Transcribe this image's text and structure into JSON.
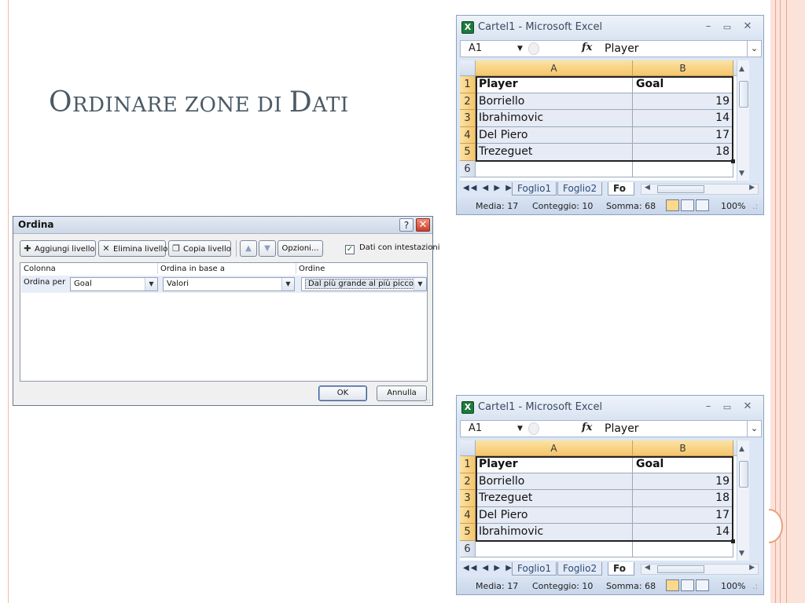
{
  "slide": {
    "title_first_cap": "O",
    "title_rest": "RDINARE ZONE DI ",
    "title_last_cap": "D",
    "title_last_rest": "ATI"
  },
  "colors": {
    "accent_line": "#f0a590",
    "title": "#4a5a66",
    "excel_header": "#f5c56a"
  },
  "excel_before": {
    "window_title": "Cartel1 - Microsoft Excel",
    "logo_icon": "excel-icon",
    "name_box": "A1",
    "fx": "fx",
    "formula_value": "Player",
    "columns": [
      "A",
      "B"
    ],
    "rows": [
      {
        "n": "1",
        "a": "Player",
        "b": "Goal"
      },
      {
        "n": "2",
        "a": "Borriello",
        "b": "19"
      },
      {
        "n": "3",
        "a": "Ibrahimovic",
        "b": "14"
      },
      {
        "n": "4",
        "a": "Del Piero",
        "b": "17"
      },
      {
        "n": "5",
        "a": "Trezeguet",
        "b": "18"
      },
      {
        "n": "6",
        "a": "",
        "b": ""
      }
    ],
    "sheet_tabs": [
      "Foglio1",
      "Foglio2",
      "Fo"
    ],
    "status": {
      "media": "Media: 17",
      "count": "Conteggio: 10",
      "sum": "Somma: 68",
      "zoom": "100%"
    }
  },
  "excel_after": {
    "window_title": "Cartel1 - Microsoft Excel",
    "logo_icon": "excel-icon",
    "name_box": "A1",
    "fx": "fx",
    "formula_value": "Player",
    "columns": [
      "A",
      "B"
    ],
    "rows": [
      {
        "n": "1",
        "a": "Player",
        "b": "Goal"
      },
      {
        "n": "2",
        "a": "Borriello",
        "b": "19"
      },
      {
        "n": "3",
        "a": "Trezeguet",
        "b": "18"
      },
      {
        "n": "4",
        "a": "Del Piero",
        "b": "17"
      },
      {
        "n": "5",
        "a": "Ibrahimovic",
        "b": "14"
      },
      {
        "n": "6",
        "a": "",
        "b": ""
      }
    ],
    "sheet_tabs": [
      "Foglio1",
      "Foglio2",
      "Fo"
    ],
    "status": {
      "media": "Media: 17",
      "count": "Conteggio: 10",
      "sum": "Somma: 68",
      "zoom": "100%"
    }
  },
  "sort_dialog": {
    "title": "Ordina",
    "help": "?",
    "buttons": {
      "add_level": "Aggiungi livello",
      "delete_level": "Elimina livello",
      "copy_level": "Copia livello",
      "options": "Opzioni...",
      "ok": "OK",
      "cancel": "Annulla"
    },
    "has_headers_label": "Dati con intestazioni",
    "has_headers_checked": true,
    "columns": {
      "col": "Colonna",
      "sort_on": "Ordina in base a",
      "order": "Ordine"
    },
    "level": {
      "label": "Ordina per",
      "column": "Goal",
      "sort_on": "Valori",
      "order": "Dal più grande al più piccolo"
    }
  }
}
